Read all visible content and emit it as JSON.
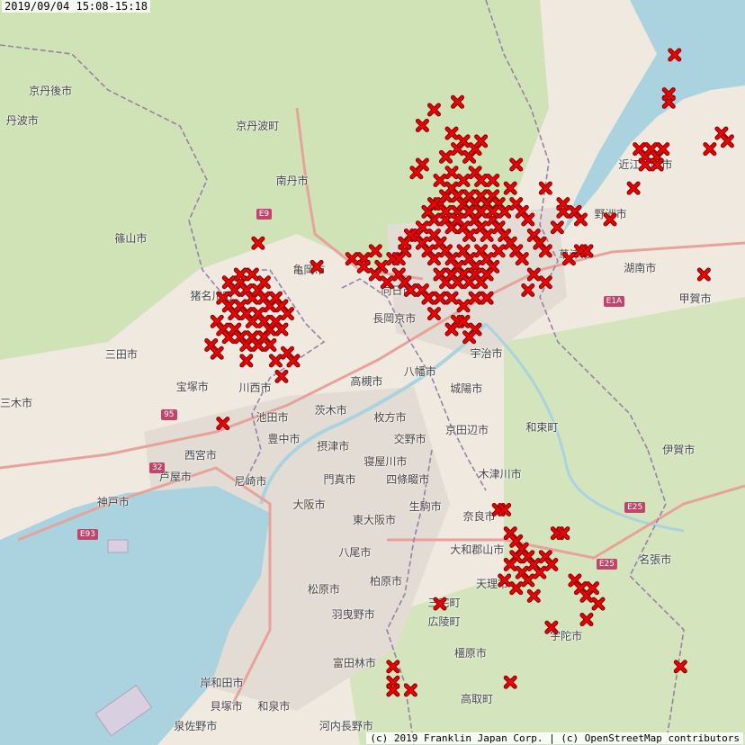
{
  "timestamp": "2019/09/04 15:08-15:18",
  "attribution": "(c) 2019 Franklin Japan Corp. | (c) OpenStreetMap contributors",
  "marker_color": "#ee0000",
  "marker_outline": "#770000",
  "place_labels": [
    {
      "text": "丹波市",
      "x": 135.021,
      "y": 35.187
    },
    {
      "text": "京丹波町",
      "x": 135.413,
      "y": 35.18
    },
    {
      "text": "南丹市",
      "x": 135.481,
      "y": 35.11
    },
    {
      "text": "篠山市",
      "x": 135.206,
      "y": 35.037
    },
    {
      "text": "亀岡市",
      "x": 135.51,
      "y": 34.997
    },
    {
      "text": "猪名川町",
      "x": 135.335,
      "y": 34.964
    },
    {
      "text": "三田市",
      "x": 135.19,
      "y": 34.889
    },
    {
      "text": "三木市",
      "x": 135.0,
      "y": 34.827
    },
    {
      "text": "宝塚市",
      "x": 135.311,
      "y": 34.848
    },
    {
      "text": "川西市",
      "x": 135.418,
      "y": 34.847
    },
    {
      "text": "池田市",
      "x": 135.447,
      "y": 34.809
    },
    {
      "text": "豊中市",
      "x": 135.467,
      "y": 34.781
    },
    {
      "text": "西宮市",
      "x": 135.325,
      "y": 34.761
    },
    {
      "text": "芦屋市",
      "x": 135.282,
      "y": 34.733
    },
    {
      "text": "尼崎市",
      "x": 135.41,
      "y": 34.727
    },
    {
      "text": "神戸市",
      "x": 135.176,
      "y": 34.701
    },
    {
      "text": "高槻市",
      "x": 135.608,
      "y": 34.855
    },
    {
      "text": "茨木市",
      "x": 135.547,
      "y": 34.818
    },
    {
      "text": "枚方市",
      "x": 135.648,
      "y": 34.809
    },
    {
      "text": "摂津市",
      "x": 135.551,
      "y": 34.772
    },
    {
      "text": "交野市",
      "x": 135.682,
      "y": 34.781
    },
    {
      "text": "寝屋川市",
      "x": 135.631,
      "y": 34.752
    },
    {
      "text": "門真市",
      "x": 135.562,
      "y": 34.73
    },
    {
      "text": "四條畷市",
      "x": 135.669,
      "y": 34.73
    },
    {
      "text": "大阪市",
      "x": 135.51,
      "y": 34.698
    },
    {
      "text": "東大阪市",
      "x": 135.612,
      "y": 34.678
    },
    {
      "text": "生駒市",
      "x": 135.708,
      "y": 34.695
    },
    {
      "text": "八尾市",
      "x": 135.588,
      "y": 34.637
    },
    {
      "text": "柏原市",
      "x": 135.641,
      "y": 34.6
    },
    {
      "text": "松原市",
      "x": 135.535,
      "y": 34.59
    },
    {
      "text": "羽曳野市",
      "x": 135.576,
      "y": 34.558
    },
    {
      "text": "富田林市",
      "x": 135.578,
      "y": 34.495
    },
    {
      "text": "岸和田市",
      "x": 135.352,
      "y": 34.47
    },
    {
      "text": "貝塚市",
      "x": 135.369,
      "y": 34.441
    },
    {
      "text": "和泉市",
      "x": 135.45,
      "y": 34.441
    },
    {
      "text": "泉佐野市",
      "x": 135.307,
      "y": 34.404
    },
    {
      "text": "河内長野市",
      "x": 135.555,
      "y": 34.404
    },
    {
      "text": "向日市",
      "x": 135.66,
      "y": 34.97
    },
    {
      "text": "長岡京市",
      "x": 135.646,
      "y": 34.935
    },
    {
      "text": "宇治市",
      "x": 135.812,
      "y": 34.89
    },
    {
      "text": "八幡市",
      "x": 135.699,
      "y": 34.867
    },
    {
      "text": "城陽市",
      "x": 135.778,
      "y": 34.845
    },
    {
      "text": "京田辺市",
      "x": 135.77,
      "y": 34.793
    },
    {
      "text": "木津川市",
      "x": 135.826,
      "y": 34.736
    },
    {
      "text": "奈良市",
      "x": 135.8,
      "y": 34.683
    },
    {
      "text": "大和郡山市",
      "x": 135.778,
      "y": 34.64
    },
    {
      "text": "天理市",
      "x": 135.822,
      "y": 34.596
    },
    {
      "text": "三宅町",
      "x": 135.74,
      "y": 34.572
    },
    {
      "text": "広陵町",
      "x": 135.74,
      "y": 34.548
    },
    {
      "text": "橿原市",
      "x": 135.785,
      "y": 34.508
    },
    {
      "text": "高取町",
      "x": 135.796,
      "y": 34.45
    },
    {
      "text": "宇陀市",
      "x": 135.948,
      "y": 34.53
    },
    {
      "text": "草津市",
      "x": 135.963,
      "y": 35.017
    },
    {
      "text": "野洲市",
      "x": 136.024,
      "y": 35.068
    },
    {
      "text": "湖南市",
      "x": 136.074,
      "y": 34.999
    },
    {
      "text": "甲賀市",
      "x": 136.168,
      "y": 34.96
    },
    {
      "text": "近江八幡市",
      "x": 136.065,
      "y": 35.131
    },
    {
      "text": "京丹後市",
      "x": 135.06,
      "y": 35.225
    },
    {
      "text": "和束町",
      "x": 135.907,
      "y": 34.796
    },
    {
      "text": "伊賀市",
      "x": 136.14,
      "y": 34.768
    },
    {
      "text": "名張市",
      "x": 136.1,
      "y": 34.627
    }
  ],
  "road_shields": [
    {
      "text": "E9",
      "x": 135.432,
      "y": 35.067
    },
    {
      "text": "95",
      "x": 135.27,
      "y": 34.811
    },
    {
      "text": "32",
      "x": 135.25,
      "y": 34.743
    },
    {
      "text": "E93",
      "x": 135.127,
      "y": 34.659
    },
    {
      "text": "E1A",
      "x": 136.024,
      "y": 34.956
    },
    {
      "text": "E25",
      "x": 136.06,
      "y": 34.693
    },
    {
      "text": "E25",
      "x": 136.012,
      "y": 34.621
    }
  ],
  "markers": [
    [
      135.58,
      35.01
    ],
    [
      135.6,
      35.01
    ],
    [
      135.62,
      35.02
    ],
    [
      135.63,
      35.0
    ],
    [
      135.65,
      35.01
    ],
    [
      135.67,
      35.02
    ],
    [
      135.69,
      35.04
    ],
    [
      135.7,
      35.05
    ],
    [
      135.72,
      35.06
    ],
    [
      135.73,
      35.08
    ],
    [
      135.74,
      35.06
    ],
    [
      135.75,
      35.05
    ],
    [
      135.76,
      35.07
    ],
    [
      135.77,
      35.05
    ],
    [
      135.78,
      35.04
    ],
    [
      135.79,
      35.06
    ],
    [
      135.8,
      35.05
    ],
    [
      135.81,
      35.04
    ],
    [
      135.82,
      35.06
    ],
    [
      135.83,
      35.05
    ],
    [
      135.84,
      35.04
    ],
    [
      135.85,
      35.03
    ],
    [
      135.86,
      35.02
    ],
    [
      135.87,
      35.01
    ],
    [
      135.72,
      35.04
    ],
    [
      135.73,
      35.03
    ],
    [
      135.74,
      35.02
    ],
    [
      135.75,
      35.01
    ],
    [
      135.76,
      35.0
    ],
    [
      135.77,
      35.02
    ],
    [
      135.78,
      35.01
    ],
    [
      135.79,
      35.0
    ],
    [
      135.8,
      35.02
    ],
    [
      135.81,
      35.01
    ],
    [
      135.82,
      35.0
    ],
    [
      135.83,
      35.02
    ],
    [
      135.71,
      35.07
    ],
    [
      135.72,
      35.08
    ],
    [
      135.74,
      35.09
    ],
    [
      135.75,
      35.1
    ],
    [
      135.76,
      35.09
    ],
    [
      135.77,
      35.08
    ],
    [
      135.78,
      35.09
    ],
    [
      135.79,
      35.08
    ],
    [
      135.8,
      35.09
    ],
    [
      135.81,
      35.08
    ],
    [
      135.82,
      35.09
    ],
    [
      135.83,
      35.08
    ],
    [
      135.73,
      35.11
    ],
    [
      135.75,
      35.12
    ],
    [
      135.77,
      35.11
    ],
    [
      135.79,
      35.12
    ],
    [
      135.8,
      35.11
    ],
    [
      135.82,
      35.11
    ],
    [
      135.74,
      35.07
    ],
    [
      135.76,
      35.06
    ],
    [
      135.78,
      35.07
    ],
    [
      135.8,
      35.07
    ],
    [
      135.82,
      35.07
    ],
    [
      135.84,
      35.07
    ],
    [
      135.7,
      35.03
    ],
    [
      135.71,
      35.02
    ],
    [
      135.72,
      35.01
    ],
    [
      135.73,
      34.99
    ],
    [
      135.74,
      34.98
    ],
    [
      135.75,
      34.99
    ],
    [
      135.76,
      34.98
    ],
    [
      135.77,
      34.99
    ],
    [
      135.78,
      34.98
    ],
    [
      135.79,
      34.99
    ],
    [
      135.8,
      34.98
    ],
    [
      135.81,
      34.99
    ],
    [
      135.66,
      34.99
    ],
    [
      135.67,
      34.98
    ],
    [
      135.68,
      34.97
    ],
    [
      135.7,
      34.97
    ],
    [
      135.71,
      34.96
    ],
    [
      135.73,
      34.96
    ],
    [
      135.75,
      34.96
    ],
    [
      135.77,
      34.95
    ],
    [
      135.79,
      34.96
    ],
    [
      135.81,
      34.96
    ],
    [
      135.72,
      34.94
    ],
    [
      135.76,
      34.93
    ],
    [
      135.86,
      35.08
    ],
    [
      135.87,
      35.07
    ],
    [
      135.88,
      35.06
    ],
    [
      135.89,
      35.04
    ],
    [
      135.9,
      35.03
    ],
    [
      135.91,
      35.02
    ],
    [
      135.93,
      35.05
    ],
    [
      135.94,
      35.07
    ],
    [
      135.95,
      35.01
    ],
    [
      135.91,
      34.98
    ],
    [
      135.89,
      34.99
    ],
    [
      135.88,
      34.97
    ],
    [
      135.76,
      35.15
    ],
    [
      135.77,
      35.16
    ],
    [
      135.78,
      35.14
    ],
    [
      135.79,
      35.15
    ],
    [
      135.8,
      35.16
    ],
    [
      135.76,
      35.21
    ],
    [
      135.7,
      35.18
    ],
    [
      135.7,
      35.13
    ],
    [
      135.69,
      35.12
    ],
    [
      135.72,
      35.2
    ],
    [
      135.75,
      35.17
    ],
    [
      135.74,
      35.14
    ],
    [
      135.85,
      35.1
    ],
    [
      135.86,
      35.13
    ],
    [
      135.91,
      35.1
    ],
    [
      135.94,
      35.08
    ],
    [
      135.96,
      35.07
    ],
    [
      135.97,
      35.06
    ],
    [
      135.68,
      35.04
    ],
    [
      135.67,
      35.03
    ],
    [
      135.66,
      35.01
    ],
    [
      135.64,
      34.98
    ],
    [
      135.62,
      34.99
    ],
    [
      135.6,
      35.0
    ],
    [
      135.79,
      34.92
    ],
    [
      135.77,
      34.93
    ],
    [
      135.75,
      34.92
    ],
    [
      135.78,
      34.91
    ],
    [
      135.37,
      34.98
    ],
    [
      135.38,
      34.97
    ],
    [
      135.39,
      34.98
    ],
    [
      135.4,
      34.97
    ],
    [
      135.41,
      34.96
    ],
    [
      135.42,
      34.97
    ],
    [
      135.43,
      34.96
    ],
    [
      135.44,
      34.95
    ],
    [
      135.45,
      34.96
    ],
    [
      135.46,
      34.95
    ],
    [
      135.36,
      34.96
    ],
    [
      135.37,
      34.95
    ],
    [
      135.38,
      34.94
    ],
    [
      135.39,
      34.95
    ],
    [
      135.4,
      34.94
    ],
    [
      135.41,
      34.93
    ],
    [
      135.42,
      34.94
    ],
    [
      135.43,
      34.93
    ],
    [
      135.44,
      34.92
    ],
    [
      135.45,
      34.93
    ],
    [
      135.46,
      34.92
    ],
    [
      135.47,
      34.94
    ],
    [
      135.35,
      34.93
    ],
    [
      135.36,
      34.92
    ],
    [
      135.37,
      34.91
    ],
    [
      135.38,
      34.92
    ],
    [
      135.39,
      34.91
    ],
    [
      135.4,
      34.9
    ],
    [
      135.41,
      34.91
    ],
    [
      135.42,
      34.9
    ],
    [
      135.43,
      34.91
    ],
    [
      135.44,
      34.9
    ],
    [
      135.34,
      34.9
    ],
    [
      135.35,
      34.89
    ],
    [
      135.39,
      34.99
    ],
    [
      135.41,
      34.99
    ],
    [
      135.43,
      34.98
    ],
    [
      135.4,
      34.88
    ],
    [
      135.45,
      34.88
    ],
    [
      135.47,
      34.89
    ],
    [
      135.48,
      34.88
    ],
    [
      135.46,
      34.86
    ],
    [
      135.42,
      35.03
    ],
    [
      135.52,
      35.0
    ],
    [
      135.36,
      34.8
    ],
    [
      136.07,
      35.15
    ],
    [
      136.08,
      35.14
    ],
    [
      136.09,
      35.15
    ],
    [
      136.1,
      35.14
    ],
    [
      136.11,
      35.15
    ],
    [
      136.08,
      35.13
    ],
    [
      136.1,
      35.13
    ],
    [
      136.12,
      35.21
    ],
    [
      136.12,
      35.22
    ],
    [
      136.13,
      35.27
    ],
    [
      136.21,
      35.17
    ],
    [
      136.22,
      35.16
    ],
    [
      136.19,
      35.15
    ],
    [
      136.06,
      35.1
    ],
    [
      136.02,
      35.06
    ],
    [
      136.18,
      34.99
    ],
    [
      135.97,
      35.02
    ],
    [
      135.98,
      35.02
    ],
    [
      135.83,
      34.69
    ],
    [
      135.84,
      34.69
    ],
    [
      135.85,
      34.66
    ],
    [
      135.86,
      34.65
    ],
    [
      135.87,
      34.64
    ],
    [
      135.88,
      34.63
    ],
    [
      135.86,
      34.63
    ],
    [
      135.85,
      34.62
    ],
    [
      135.87,
      34.61
    ],
    [
      135.88,
      34.6
    ],
    [
      135.89,
      34.62
    ],
    [
      135.9,
      34.61
    ],
    [
      135.91,
      34.63
    ],
    [
      135.92,
      34.62
    ],
    [
      135.84,
      34.6
    ],
    [
      135.86,
      34.59
    ],
    [
      135.89,
      34.58
    ],
    [
      135.93,
      34.66
    ],
    [
      135.94,
      34.66
    ],
    [
      135.96,
      34.6
    ],
    [
      135.97,
      34.59
    ],
    [
      135.98,
      34.58
    ],
    [
      135.99,
      34.59
    ],
    [
      136.0,
      34.57
    ],
    [
      135.98,
      34.55
    ],
    [
      135.92,
      34.54
    ],
    [
      135.73,
      34.57
    ],
    [
      135.85,
      34.47
    ],
    [
      136.14,
      34.49
    ],
    [
      135.65,
      34.49
    ],
    [
      135.65,
      34.47
    ],
    [
      135.65,
      34.46
    ],
    [
      135.68,
      34.46
    ]
  ]
}
